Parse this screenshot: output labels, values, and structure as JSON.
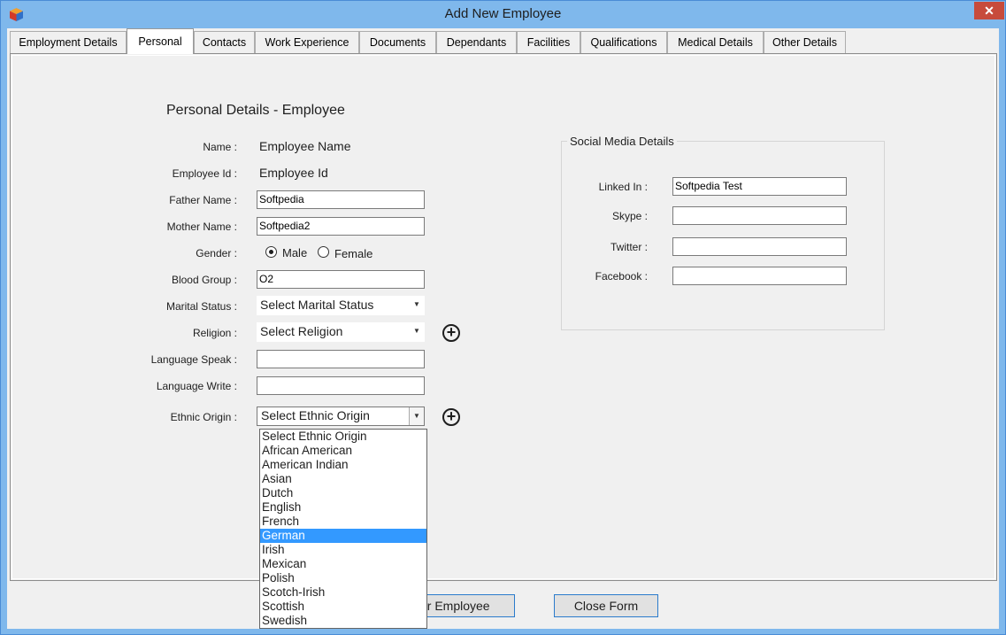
{
  "window": {
    "title": "Add New Employee",
    "close_glyph": "✕"
  },
  "tabs": [
    {
      "label": "Employment Details"
    },
    {
      "label": "Personal"
    },
    {
      "label": "Contacts"
    },
    {
      "label": "Work Experience"
    },
    {
      "label": "Documents"
    },
    {
      "label": "Dependants"
    },
    {
      "label": "Facilities"
    },
    {
      "label": "Qualifications"
    },
    {
      "label": "Medical Details"
    },
    {
      "label": "Other Details"
    }
  ],
  "active_tab": "Personal",
  "personal": {
    "heading": "Personal Details - Employee",
    "name_label": "Name :",
    "name_value": "Employee Name",
    "employee_id_label": "Employee Id :",
    "employee_id_value": "Employee Id",
    "father_name_label": "Father Name :",
    "father_name_value": "Softpedia",
    "mother_name_label": "Mother Name :",
    "mother_name_value": "Softpedia2",
    "gender_label": "Gender :",
    "gender_male": "Male",
    "gender_female": "Female",
    "gender_selected": "Male",
    "blood_group_label": "Blood Group :",
    "blood_group_value": "O2",
    "marital_status_label": "Marital Status :",
    "marital_status_value": "Select Marital Status",
    "religion_label": "Religion :",
    "religion_value": "Select Religion",
    "language_speak_label": "Language Speak :",
    "language_speak_value": "",
    "language_write_label": "Language Write :",
    "language_write_value": "",
    "ethnic_origin_label": "Ethnic Origin :",
    "ethnic_origin_value": "Select Ethnic Origin",
    "ethnic_options": [
      "Select Ethnic Origin",
      "African American",
      "American Indian",
      "Asian",
      "Dutch",
      "English",
      "French",
      "German",
      "Irish",
      "Mexican",
      "Polish",
      "Scotch-Irish",
      "Scottish",
      "Swedish"
    ],
    "ethnic_highlighted": "German"
  },
  "social": {
    "title": "Social Media Details",
    "linkedin_label": "Linked In :",
    "linkedin_value": "Softpedia Test",
    "skype_label": "Skype :",
    "skype_value": "",
    "twitter_label": "Twitter :",
    "twitter_value": "",
    "facebook_label": "Facebook :",
    "facebook_value": ""
  },
  "buttons": {
    "add_another": "Add Another Employee",
    "close_form": "Close Form"
  },
  "icons": {
    "add": "plus-circle-icon",
    "dropdown": "chevron-down-icon",
    "app": "app-cube-icon",
    "close": "close-icon"
  },
  "colors": {
    "window_frame": "#7fb8ec",
    "close_button": "#c74b3c",
    "selection": "#3399ff",
    "button_border": "#2b7bcc"
  }
}
